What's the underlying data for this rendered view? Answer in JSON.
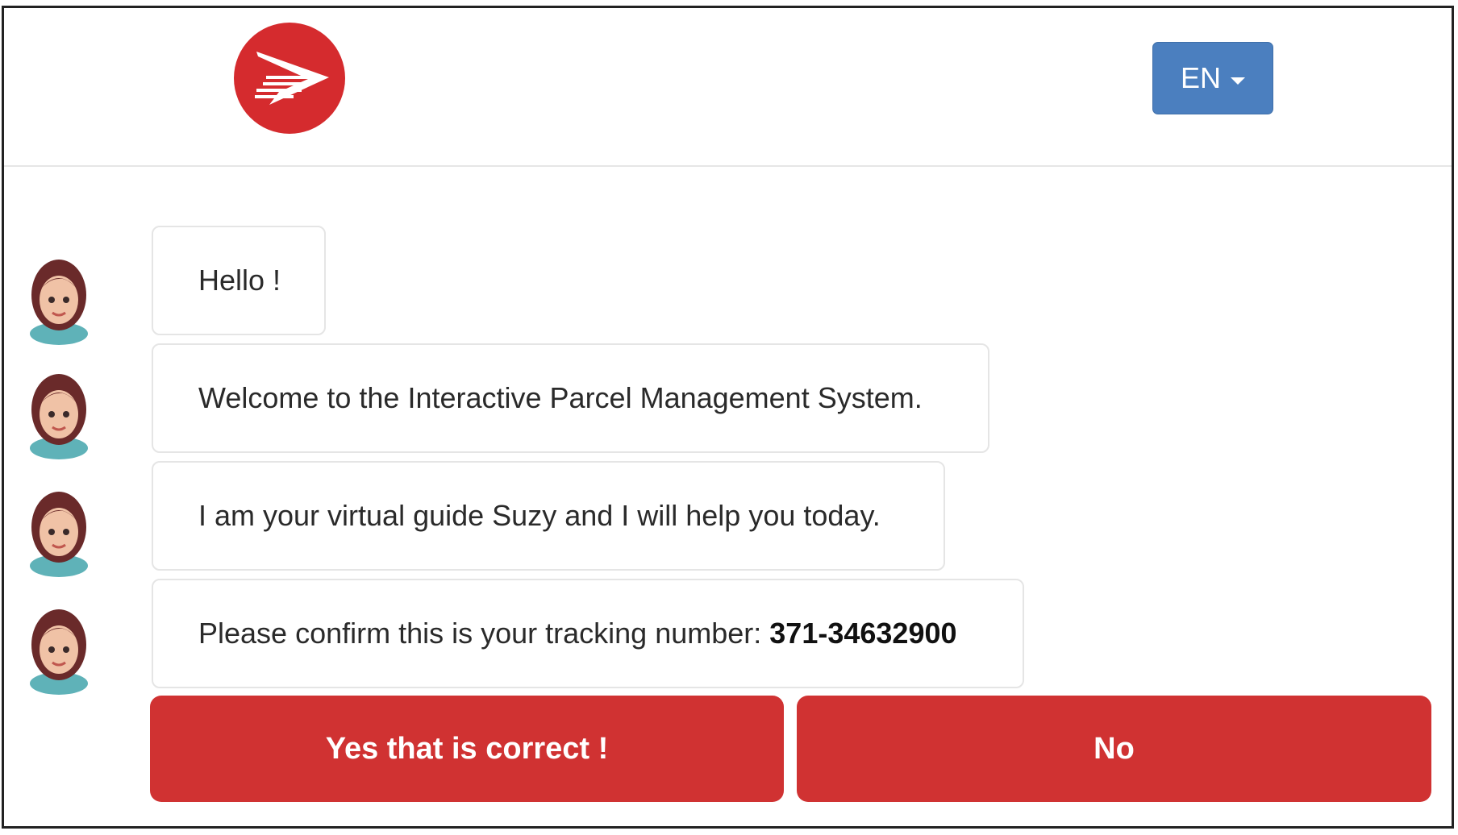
{
  "header": {
    "logo_icon": "canada-post-logo-icon",
    "language": {
      "label": "EN",
      "icon": "caret-down-icon",
      "color": "#4b7fbf"
    }
  },
  "chat": {
    "avatar_icon": "assistant-avatar-icon",
    "messages": [
      {
        "text": "Hello !"
      },
      {
        "text": "Welcome to the Interactive Parcel Management System."
      },
      {
        "text": "I am your virtual guide Suzy and I will help you today."
      },
      {
        "text": "Please confirm this is your tracking number: ",
        "tracking_number": "371-34632900"
      }
    ]
  },
  "actions": {
    "yes_label": "Yes that is correct !",
    "no_label": "No",
    "color": "#d03232"
  },
  "brand": {
    "primary_color": "#d52b2e"
  }
}
